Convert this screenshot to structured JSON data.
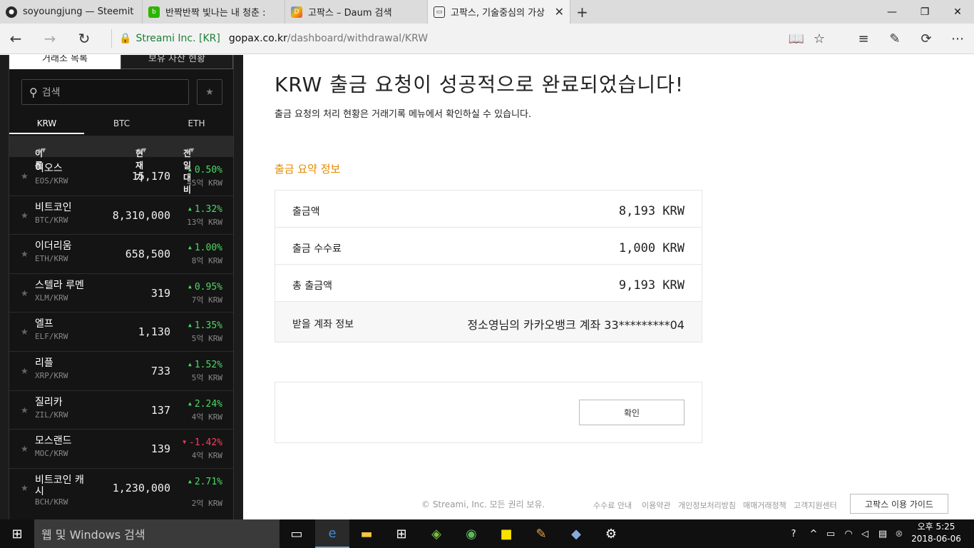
{
  "browser": {
    "tabs": [
      {
        "label": "soyoungjung — Steemit",
        "icon": "steemit-icon",
        "active": false
      },
      {
        "label": "반짝반짝 빛나는 내 청춘 : ",
        "icon": "blog-icon",
        "active": false
      },
      {
        "label": "고팍스 – Daum 검색",
        "icon": "daum-icon",
        "active": false
      },
      {
        "label": "고팍스, 기술중심의 가상",
        "icon": "page-icon",
        "active": true
      }
    ],
    "address": {
      "org": "Streami Inc. [KR]",
      "host": "gopax.co.kr",
      "path": "/dashboard/withdrawal/KRW"
    }
  },
  "sidebar": {
    "top_tabs": [
      "거래소 목록",
      "보유 자산 현황"
    ],
    "search_placeholder": "검색",
    "market_tabs": [
      "KRW",
      "BTC",
      "ETH"
    ],
    "columns": {
      "name": "이름",
      "price": "현재가",
      "change": "전일대비"
    },
    "rows": [
      {
        "name": "이오스",
        "symbol": "EOS/KRW",
        "price": "15,170",
        "change": "0.50%",
        "dir": "up",
        "volume": "45억 KRW"
      },
      {
        "name": "비트코인",
        "symbol": "BTC/KRW",
        "price": "8,310,000",
        "change": "1.32%",
        "dir": "up",
        "volume": "13억 KRW"
      },
      {
        "name": "이더리움",
        "symbol": "ETH/KRW",
        "price": "658,500",
        "change": "1.00%",
        "dir": "up",
        "volume": "8억 KRW"
      },
      {
        "name": "스텔라 루멘",
        "symbol": "XLM/KRW",
        "price": "319",
        "change": "0.95%",
        "dir": "up",
        "volume": "7억 KRW"
      },
      {
        "name": "엘프",
        "symbol": "ELF/KRW",
        "price": "1,130",
        "change": "1.35%",
        "dir": "up",
        "volume": "5억 KRW"
      },
      {
        "name": "리플",
        "symbol": "XRP/KRW",
        "price": "733",
        "change": "1.52%",
        "dir": "up",
        "volume": "5억 KRW"
      },
      {
        "name": "질리카",
        "symbol": "ZIL/KRW",
        "price": "137",
        "change": "2.24%",
        "dir": "up",
        "volume": "4억 KRW"
      },
      {
        "name": "모스랜드",
        "symbol": "MOC/KRW",
        "price": "139",
        "change": "-1.42%",
        "dir": "down",
        "volume": "4억 KRW"
      },
      {
        "name": "비트코인 캐시",
        "symbol": "BCH/KRW",
        "price": "1,230,000",
        "change": "2.71%",
        "dir": "up",
        "volume": "2억 KRW"
      }
    ]
  },
  "main": {
    "title": "KRW 출금 요청이 성공적으로 완료되었습니다!",
    "subtitle": "출금 요청의 처리 현황은 거래기록 메뉴에서 확인하실 수 있습니다.",
    "summary_label": "출금 요약 정보",
    "summary": [
      {
        "label": "출금액",
        "value": "8,193 KRW"
      },
      {
        "label": "출금 수수료",
        "value": "1,000 KRW"
      },
      {
        "label": "총 출금액",
        "value": "9,193 KRW"
      },
      {
        "label": "받을 계좌 정보",
        "value": "정소영님의 카카오뱅크 계좌 33*********04"
      }
    ],
    "confirm_label": "확인"
  },
  "footer": {
    "copyright": "© Streami, Inc. 모든 권리 보유.",
    "links": [
      "수수료 안내",
      "이용약관",
      "개인정보처리방침",
      "매매거래정책",
      "고객지원센터"
    ],
    "guide_label": "고팍스 이용 가이드"
  },
  "taskbar": {
    "search_placeholder": "웹 및 Windows 검색",
    "time": "오후 5:25",
    "date": "2018-06-06"
  },
  "colors": {
    "accent": "#e08a00",
    "up": "#4cd964",
    "down": "#ff3b5c",
    "secure": "#1a7f37"
  }
}
